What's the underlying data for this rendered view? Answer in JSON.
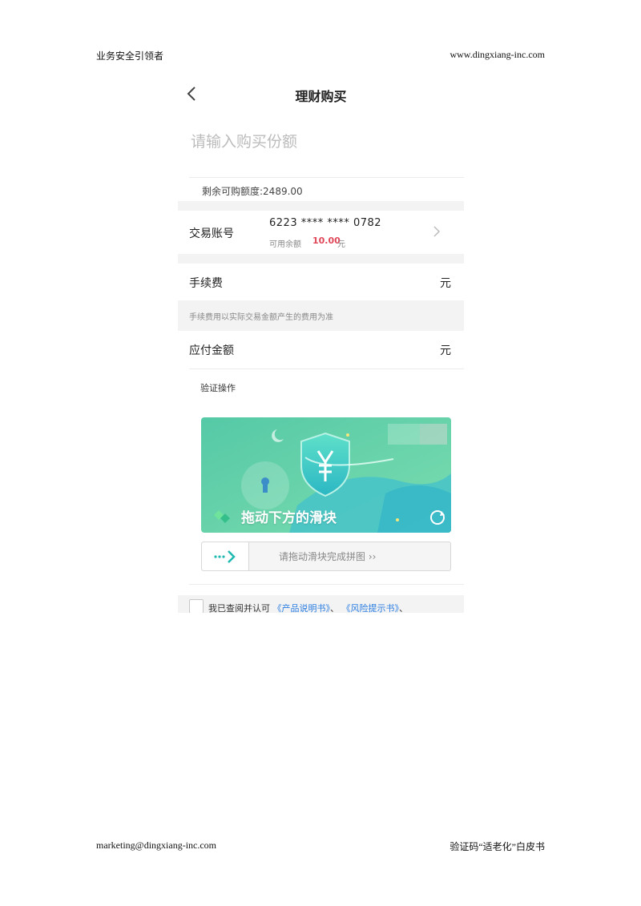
{
  "document": {
    "header_left": "业务安全引领者",
    "header_right": "www.dingxiang-inc.com",
    "footer_left": "marketing@dingxiang-inc.com",
    "footer_right": "验证码“适老化”白皮书"
  },
  "screen": {
    "nav": {
      "title": "理财购买",
      "back_icon": "chevron-left-icon"
    },
    "amount_input": {
      "placeholder": "请输入购买份额",
      "value": ""
    },
    "remaining_quota": "剩余可购额度:2489.00",
    "account": {
      "label": "交易账号",
      "card_number": "6223 **** **** 0782",
      "balance_label": "可用余额",
      "balance_value": "10.00",
      "balance_unit": "元",
      "chevron_icon": "chevron-right-icon"
    },
    "fee": {
      "label": "手续费",
      "unit": "元",
      "note": "手续费用以实际交易金额产生的费用为准"
    },
    "payable": {
      "label": "应付金额",
      "unit": "元"
    },
    "verify": {
      "title": "验证操作",
      "captcha_hint": "拖动下方的滑块",
      "refresh_icon": "refresh-icon",
      "slider_hint": "请拖动滑块完成拼图 ››",
      "slider_icon": "arrow-right-icon"
    },
    "agreement": {
      "prefix": "我已查阅并认可",
      "link1": "《产品说明书》",
      "sep1": "、",
      "link2": "《风险提示书》",
      "sep2": "、"
    },
    "colors": {
      "accent_link": "#2a7de1",
      "balance_red": "#e0485a",
      "captcha_green": "#5fd3a6",
      "slider_teal": "#1fb9b0"
    }
  }
}
